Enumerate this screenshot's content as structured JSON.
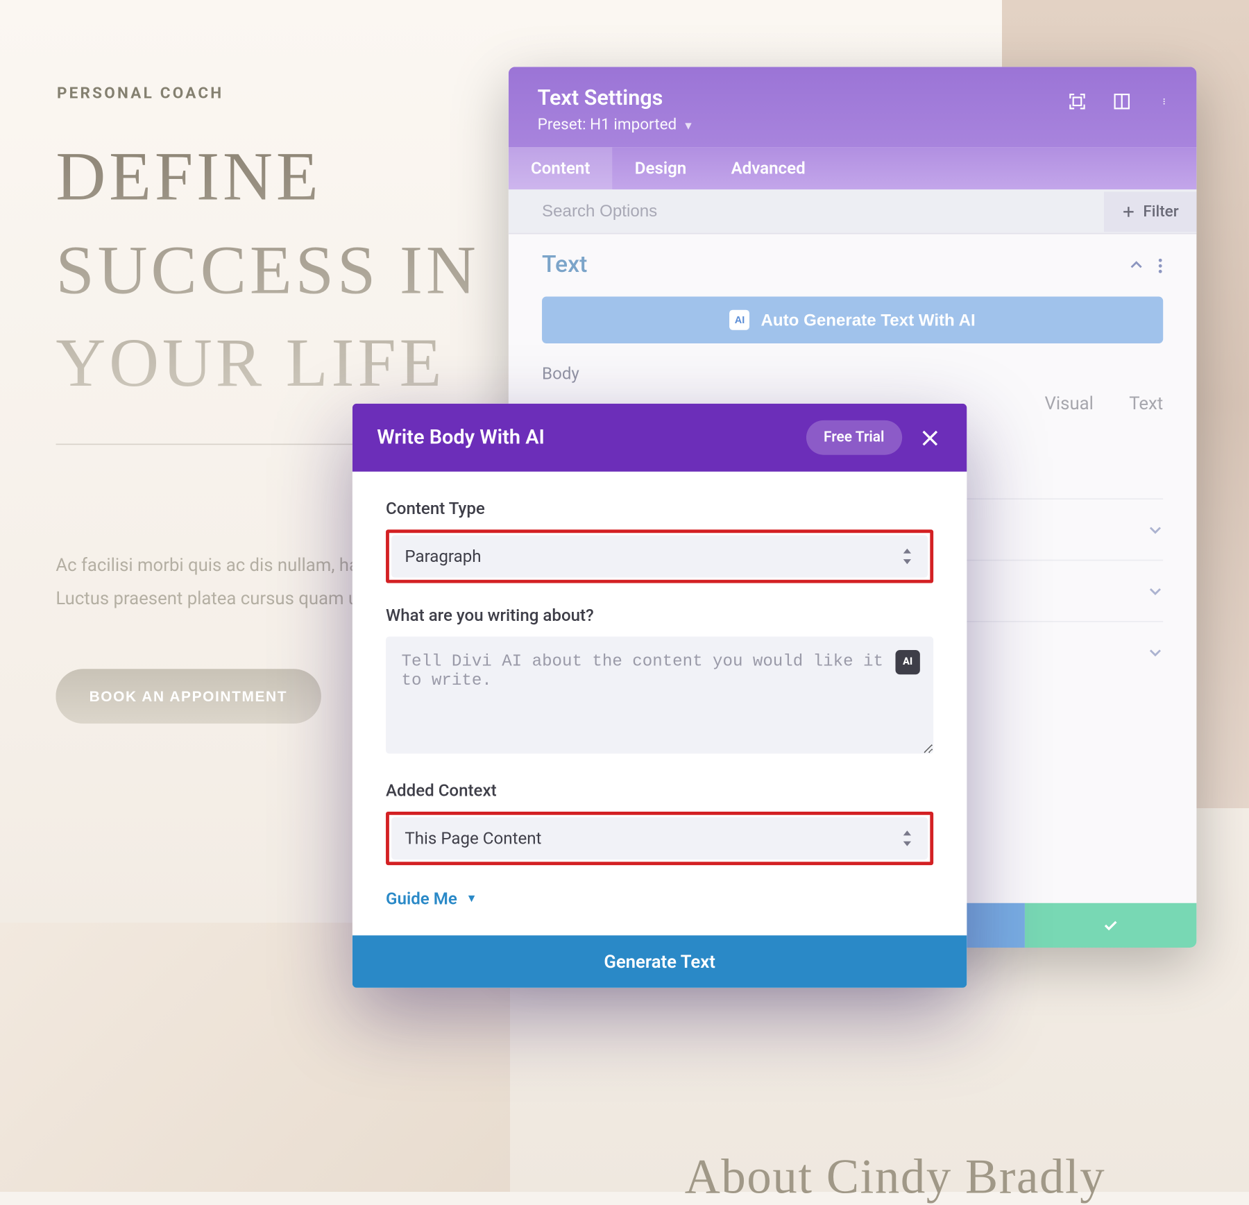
{
  "hero": {
    "kicker": "PERSONAL COACH",
    "title": "DEFINE SUCCESS IN YOUR LIFE",
    "description": "Ac facilisi morbi quis ac dis nullam, hac vestibulum. Luctus praesent platea cursus quam ultricies. T",
    "cta": "BOOK AN APPOINTMENT",
    "preview_heading": "Life",
    "about_heading": "About Cindy Bradly"
  },
  "panel": {
    "title": "Text Settings",
    "preset_label": "Preset: H1 imported",
    "tabs": {
      "content": "Content",
      "design": "Design",
      "advanced": "Advanced"
    },
    "search_placeholder": "Search Options",
    "filter_label": "Filter",
    "text_section_title": "Text",
    "auto_generate_label": "Auto Generate Text With AI",
    "body_label": "Body",
    "editor_tabs": {
      "visual": "Visual",
      "text": "Text"
    }
  },
  "modal": {
    "title": "Write Body With AI",
    "trial": "Free Trial",
    "content_type_label": "Content Type",
    "content_type_value": "Paragraph",
    "prompt_label": "What are you writing about?",
    "prompt_placeholder": "Tell Divi AI about the content you would like it to write.",
    "context_label": "Added Context",
    "context_value": "This Page Content",
    "guide_me": "Guide Me",
    "generate": "Generate Text"
  }
}
